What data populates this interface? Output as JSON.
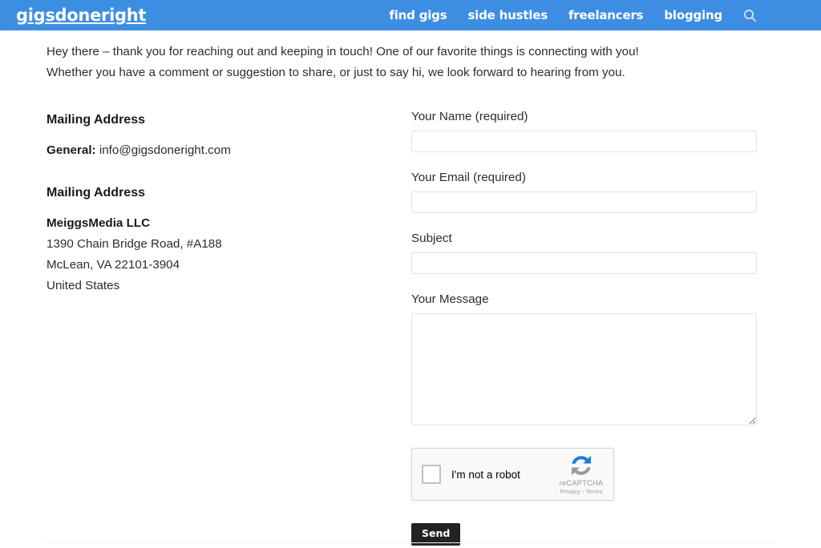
{
  "header": {
    "logo": "gigsdoneright",
    "brand_color": "#3d8ee3",
    "nav": [
      {
        "label": "find gigs",
        "name": "nav-find-gigs"
      },
      {
        "label": "side hustles",
        "name": "nav-side-hustles"
      },
      {
        "label": "freelancers",
        "name": "nav-freelancers"
      },
      {
        "label": "blogging",
        "name": "nav-blogging"
      }
    ],
    "search_icon": "search-icon"
  },
  "intro": "Hey there – thank you for reaching out and keeping in touch! One of our favorite things is connecting with you! Whether you have a comment or suggestion to share, or just to say hi, we look forward to hearing from you.",
  "contact": {
    "heading_1": "Mailing Address",
    "general_label": "General:",
    "general_email": "info@gigsdoneright.com",
    "heading_2": "Mailing Address",
    "company": "MeiggsMedia LLC",
    "street": "1390 Chain Bridge Road, #A188",
    "city_state_zip": "McLean, VA 22101-3904",
    "country": "United States"
  },
  "form": {
    "name_label": "Your Name (required)",
    "name_value": "",
    "name_placeholder": "",
    "email_label": "Your Email (required)",
    "email_value": "",
    "email_placeholder": "",
    "subject_label": "Subject",
    "subject_value": "",
    "subject_placeholder": "",
    "message_label": "Your Message",
    "message_value": "",
    "message_placeholder": "",
    "submit_label": "Send",
    "submit_color": "#222222"
  },
  "recaptcha": {
    "checkbox_label": "I'm not a robot",
    "brand": "reCAPTCHA",
    "links": "Privacy - Terms",
    "logo_icon": "recaptcha-icon"
  }
}
